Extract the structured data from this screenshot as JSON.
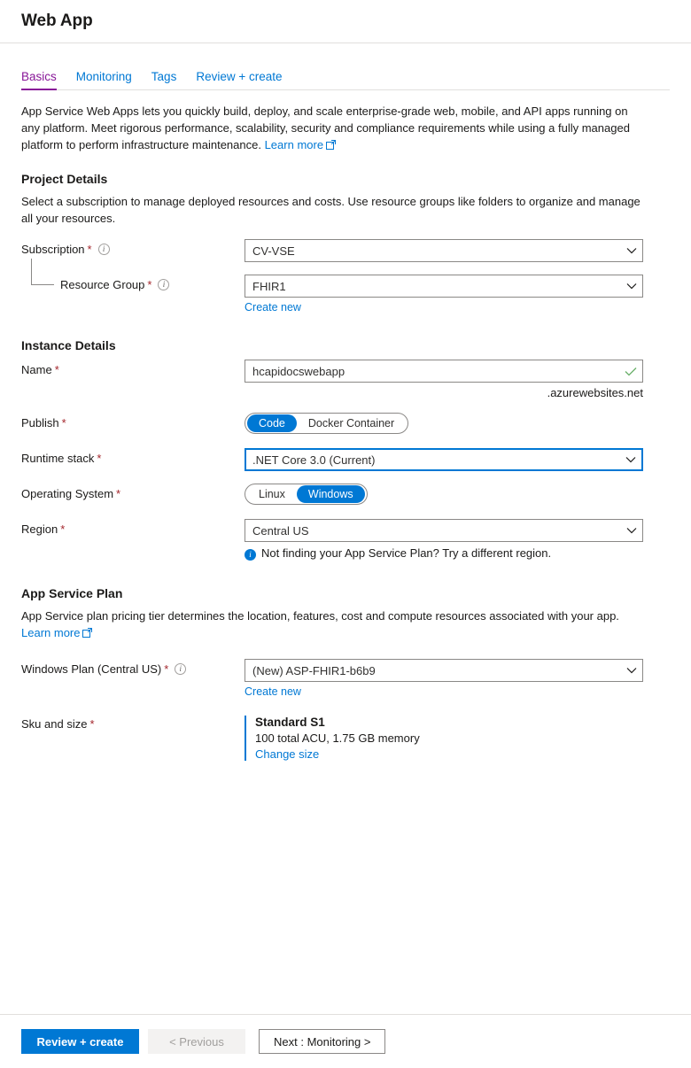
{
  "header": {
    "title": "Web App"
  },
  "tabs": [
    {
      "label": "Basics",
      "active": true
    },
    {
      "label": "Monitoring",
      "active": false
    },
    {
      "label": "Tags",
      "active": false
    },
    {
      "label": "Review + create",
      "active": false
    }
  ],
  "intro": {
    "text": "App Service Web Apps lets you quickly build, deploy, and scale enterprise-grade web, mobile, and API apps running on any platform. Meet rigorous performance, scalability, security and compliance requirements while using a fully managed platform to perform infrastructure maintenance.",
    "learn_more": "Learn more"
  },
  "project_details": {
    "title": "Project Details",
    "description": "Select a subscription to manage deployed resources and costs. Use resource groups like folders to organize and manage all your resources.",
    "subscription": {
      "label": "Subscription",
      "required": "*",
      "value": "CV-VSE"
    },
    "resource_group": {
      "label": "Resource Group",
      "required": "*",
      "value": "FHIR1",
      "create_new": "Create new"
    }
  },
  "instance_details": {
    "title": "Instance Details",
    "name": {
      "label": "Name",
      "required": "*",
      "value": "hcapidocswebapp",
      "suffix": ".azurewebsites.net",
      "validation": "valid"
    },
    "publish": {
      "label": "Publish",
      "required": "*",
      "options": [
        "Code",
        "Docker Container"
      ],
      "selected": "Code"
    },
    "runtime_stack": {
      "label": "Runtime stack",
      "required": "*",
      "value": ".NET Core 3.0 (Current)",
      "focused": true
    },
    "operating_system": {
      "label": "Operating System",
      "required": "*",
      "options": [
        "Linux",
        "Windows"
      ],
      "selected": "Windows"
    },
    "region": {
      "label": "Region",
      "required": "*",
      "value": "Central US",
      "info": "Not finding your App Service Plan? Try a different region."
    }
  },
  "app_service_plan": {
    "title": "App Service Plan",
    "description": "App Service plan pricing tier determines the location, features, cost and compute resources associated with your app.",
    "learn_more": "Learn more",
    "windows_plan": {
      "label": "Windows Plan (Central US)",
      "required": "*",
      "value": "(New) ASP-FHIR1-b6b9",
      "create_new": "Create new"
    },
    "sku_and_size": {
      "label": "Sku and size",
      "required": "*",
      "name": "Standard S1",
      "specs": "100 total ACU, 1.75 GB memory",
      "change_link": "Change size"
    }
  },
  "footer": {
    "review_create": "Review + create",
    "previous": "< Previous",
    "next": "Next : Monitoring >"
  },
  "colors": {
    "accent_blue": "#0078d4",
    "tab_active": "#881798",
    "required_red": "#a4262c",
    "valid_green": "#69af69"
  },
  "icons": {
    "info": "i",
    "chevron_down": "chevron-down-icon",
    "external_link": "external-link-icon",
    "checkmark": "checkmark-icon"
  }
}
